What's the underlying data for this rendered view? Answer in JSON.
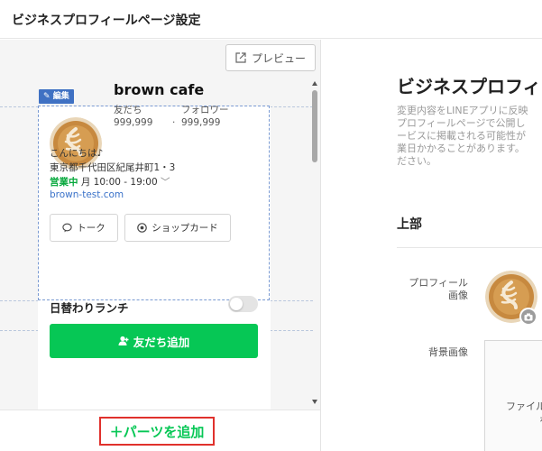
{
  "header": {
    "title": "ビジネスプロフィールページ設定"
  },
  "preview": {
    "preview_label": "プレビュー"
  },
  "card": {
    "edit_tag": "編集",
    "shop_name": "brown cafe",
    "friends_label": "友だち",
    "friends_value": "999,999",
    "followers_label": "フォロワー",
    "followers_value": "999,999",
    "greeting": "こんにちは♪",
    "address": "東京都千代田区紀尾井町1・3",
    "hours_status": "営業中",
    "hours_text": "月 10:00 - 19:00",
    "url": "brown-test.com",
    "talk_label": "トーク",
    "shopcard_label": "ショップカード"
  },
  "lunch": {
    "label": "日替わりランチ",
    "toggle_on": false
  },
  "add_friend": {
    "label": "友だち追加"
  },
  "add_parts": {
    "label": "＋パーツを追加"
  },
  "right_panel": {
    "title": "ビジネスプロフィ",
    "desc_lines": [
      "変更内容をLINEアプリに反映",
      "プロフィールページで公開し",
      "ービスに掲載される可能性が",
      "業日かかることがあります。",
      "ださい。"
    ],
    "section": "上部",
    "profile_image_label_1": "プロフィール",
    "profile_image_label_2": "画像",
    "bg_image_label": "背景画像",
    "upload_text_1": "ファイル",
    "upload_text_2": "を"
  },
  "colors": {
    "brand_green": "#06c755",
    "edit_blue": "#3f71c3",
    "highlight_red": "#e0312c"
  }
}
